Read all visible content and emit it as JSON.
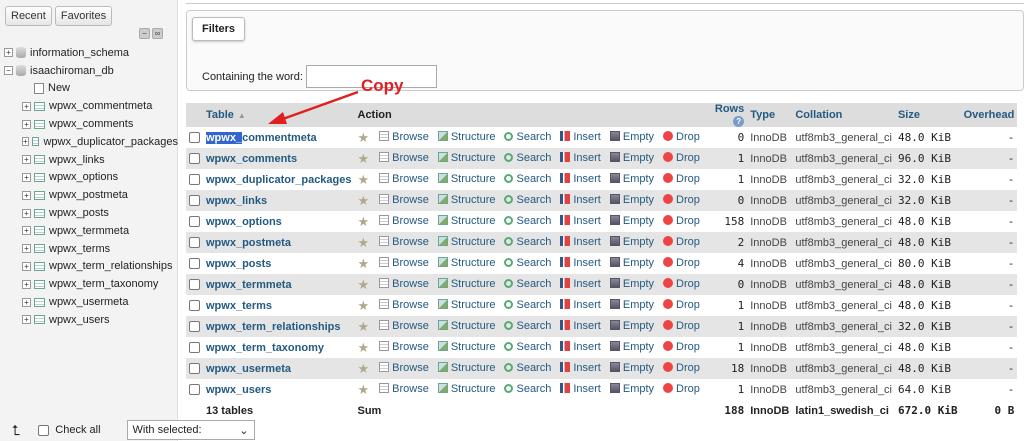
{
  "sidebar": {
    "tabs": [
      "Recent",
      "Favorites"
    ],
    "tree": [
      {
        "label": "information_schema",
        "level": 0,
        "icon": "database-icon"
      },
      {
        "label": "isaachiroman_db",
        "level": 0,
        "icon": "database-icon"
      },
      {
        "label": "New",
        "level": 1,
        "icon": "new-icon"
      },
      {
        "label": "wpwx_commentmeta",
        "level": 1,
        "icon": "table-icon"
      },
      {
        "label": "wpwx_comments",
        "level": 1,
        "icon": "table-icon"
      },
      {
        "label": "wpwx_duplicator_packages",
        "level": 1,
        "icon": "table-icon"
      },
      {
        "label": "wpwx_links",
        "level": 1,
        "icon": "table-icon"
      },
      {
        "label": "wpwx_options",
        "level": 1,
        "icon": "table-icon"
      },
      {
        "label": "wpwx_postmeta",
        "level": 1,
        "icon": "table-icon"
      },
      {
        "label": "wpwx_posts",
        "level": 1,
        "icon": "table-icon"
      },
      {
        "label": "wpwx_termmeta",
        "level": 1,
        "icon": "table-icon"
      },
      {
        "label": "wpwx_terms",
        "level": 1,
        "icon": "table-icon"
      },
      {
        "label": "wpwx_term_relationships",
        "level": 1,
        "icon": "table-icon"
      },
      {
        "label": "wpwx_term_taxonomy",
        "level": 1,
        "icon": "table-icon"
      },
      {
        "label": "wpwx_usermeta",
        "level": 1,
        "icon": "table-icon"
      },
      {
        "label": "wpwx_users",
        "level": 1,
        "icon": "table-icon"
      }
    ]
  },
  "filters": {
    "legend": "Filters",
    "label": "Containing the word:",
    "value": ""
  },
  "annotation": {
    "text": "Copy",
    "color": "#e02020"
  },
  "table": {
    "headers": {
      "table": "Table",
      "action": "Action",
      "rows": "Rows",
      "rows_help": "?",
      "type": "Type",
      "collation": "Collation",
      "size": "Size",
      "overhead": "Overhead"
    },
    "actions": [
      "Browse",
      "Structure",
      "Search",
      "Insert",
      "Empty",
      "Drop"
    ],
    "rows": [
      {
        "name_sel": "wpwx_",
        "name_rest": "commentmeta",
        "rows": "0",
        "type": "InnoDB",
        "collation": "utf8mb3_general_ci",
        "size": "48.0 KiB",
        "overhead": "-"
      },
      {
        "name_sel": "",
        "name_rest": "wpwx_comments",
        "rows": "1",
        "type": "InnoDB",
        "collation": "utf8mb3_general_ci",
        "size": "96.0 KiB",
        "overhead": "-"
      },
      {
        "name_sel": "",
        "name_rest": "wpwx_duplicator_packages",
        "rows": "1",
        "type": "InnoDB",
        "collation": "utf8mb3_general_ci",
        "size": "32.0 KiB",
        "overhead": "-"
      },
      {
        "name_sel": "",
        "name_rest": "wpwx_links",
        "rows": "0",
        "type": "InnoDB",
        "collation": "utf8mb3_general_ci",
        "size": "32.0 KiB",
        "overhead": "-"
      },
      {
        "name_sel": "",
        "name_rest": "wpwx_options",
        "rows": "158",
        "type": "InnoDB",
        "collation": "utf8mb3_general_ci",
        "size": "48.0 KiB",
        "overhead": "-"
      },
      {
        "name_sel": "",
        "name_rest": "wpwx_postmeta",
        "rows": "2",
        "type": "InnoDB",
        "collation": "utf8mb3_general_ci",
        "size": "48.0 KiB",
        "overhead": "-"
      },
      {
        "name_sel": "",
        "name_rest": "wpwx_posts",
        "rows": "4",
        "type": "InnoDB",
        "collation": "utf8mb3_general_ci",
        "size": "80.0 KiB",
        "overhead": "-"
      },
      {
        "name_sel": "",
        "name_rest": "wpwx_termmeta",
        "rows": "0",
        "type": "InnoDB",
        "collation": "utf8mb3_general_ci",
        "size": "48.0 KiB",
        "overhead": "-"
      },
      {
        "name_sel": "",
        "name_rest": "wpwx_terms",
        "rows": "1",
        "type": "InnoDB",
        "collation": "utf8mb3_general_ci",
        "size": "48.0 KiB",
        "overhead": "-"
      },
      {
        "name_sel": "",
        "name_rest": "wpwx_term_relationships",
        "rows": "1",
        "type": "InnoDB",
        "collation": "utf8mb3_general_ci",
        "size": "32.0 KiB",
        "overhead": "-"
      },
      {
        "name_sel": "",
        "name_rest": "wpwx_term_taxonomy",
        "rows": "1",
        "type": "InnoDB",
        "collation": "utf8mb3_general_ci",
        "size": "48.0 KiB",
        "overhead": "-"
      },
      {
        "name_sel": "",
        "name_rest": "wpwx_usermeta",
        "rows": "18",
        "type": "InnoDB",
        "collation": "utf8mb3_general_ci",
        "size": "48.0 KiB",
        "overhead": "-"
      },
      {
        "name_sel": "",
        "name_rest": "wpwx_users",
        "rows": "1",
        "type": "InnoDB",
        "collation": "utf8mb3_general_ci",
        "size": "64.0 KiB",
        "overhead": "-"
      }
    ],
    "footer": {
      "count": "13 tables",
      "sum": "Sum",
      "rows": "188",
      "type": "InnoDB",
      "collation": "latin1_swedish_ci",
      "size": "672.0 KiB",
      "overhead": "0 B"
    }
  },
  "bottom": {
    "check_all": "Check all",
    "with_selected": "With selected:"
  }
}
